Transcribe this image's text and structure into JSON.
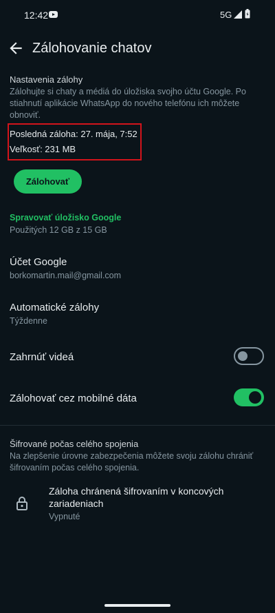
{
  "status_bar": {
    "time": "12:42",
    "network": "5G",
    "icons": [
      "youtube-icon",
      "signal-icon",
      "battery-icon"
    ]
  },
  "app_bar": {
    "title": "Zálohovanie chatov",
    "back_icon": "arrow-left-icon"
  },
  "backup_settings": {
    "heading": "Nastavenia zálohy",
    "description": "Zálohujte si chaty a médiá do úložiska svojho účtu Google. Po stiahnutí aplikácie WhatsApp do nového telefónu ich môžete obnoviť.",
    "last_backup": "Posledná záloha: 27. mája, 7:52",
    "size": "Veľkosť: 231 MB",
    "backup_button": "Zálohovať"
  },
  "storage": {
    "manage_link": "Spravovať úložisko Google",
    "usage": "Použitých 12 GB z 15 GB"
  },
  "settings": {
    "google_account": {
      "title": "Účet Google",
      "value": "borkomartin.mail@gmail.com"
    },
    "auto_backup": {
      "title": "Automatické zálohy",
      "value": "Týždenne"
    },
    "include_videos": {
      "title": "Zahrnúť videá",
      "enabled": false
    },
    "mobile_data": {
      "title": "Zálohovať cez mobilné dáta",
      "enabled": true
    }
  },
  "encryption": {
    "heading": "Šifrované počas celého spojenia",
    "description": "Na zlepšenie úrovne zabezpečenia môžete svoju zálohu chrániť šifrovaním počas celého spojenia.",
    "item_title": "Záloha chránená šifrovaním v koncových zariadeniach",
    "item_status": "Vypnuté",
    "icon": "lock-icon"
  },
  "colors": {
    "background": "#0b141a",
    "accent": "#21c063",
    "secondary_text": "#8696a0",
    "highlight": "#d3141b"
  }
}
